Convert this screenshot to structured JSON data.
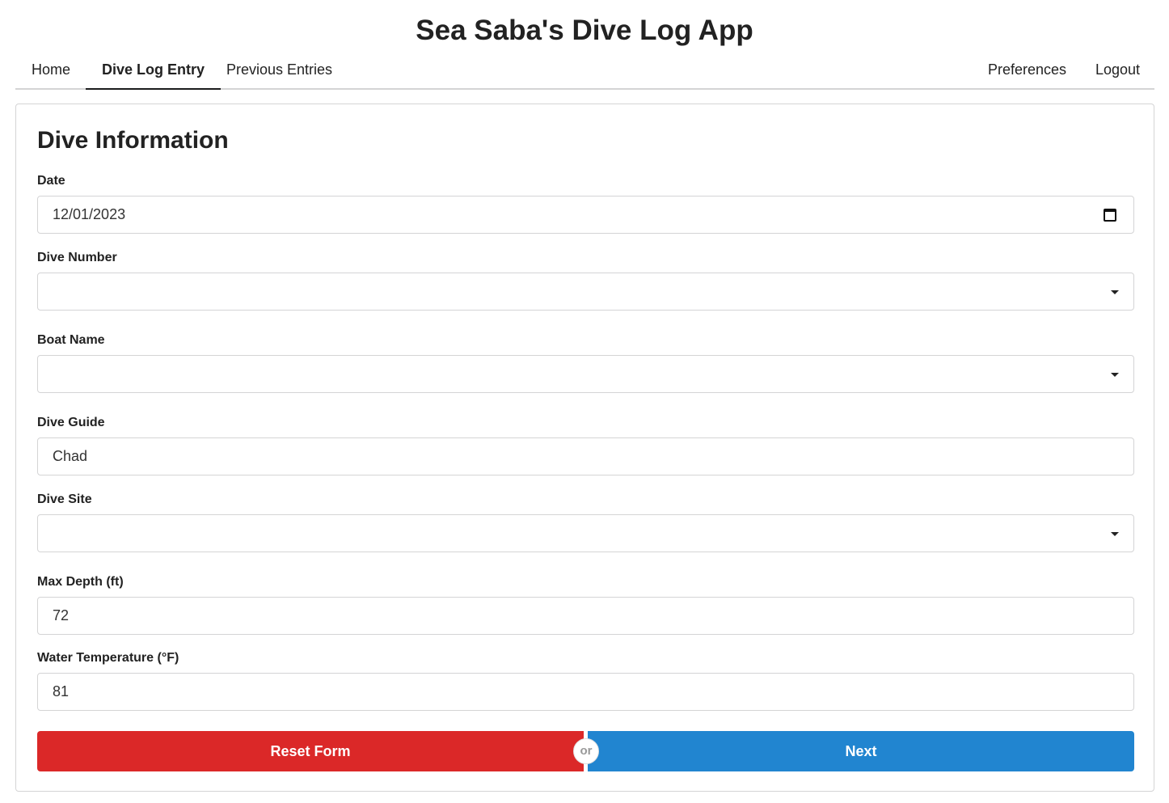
{
  "app": {
    "title": "Sea Saba's Dive Log App"
  },
  "nav": {
    "left": [
      {
        "label": "Home",
        "active": false
      },
      {
        "label": "Dive Log Entry",
        "active": true
      },
      {
        "label": "Previous Entries",
        "active": false
      }
    ],
    "right": [
      {
        "label": "Preferences"
      },
      {
        "label": "Logout"
      }
    ]
  },
  "form": {
    "title": "Dive Information",
    "fields": {
      "date": {
        "label": "Date",
        "value": "12/01/2023",
        "icon": "calendar-icon"
      },
      "dive_number": {
        "label": "Dive Number",
        "value": "",
        "icon": "caret-down-icon"
      },
      "boat_name": {
        "label": "Boat Name",
        "value": "",
        "icon": "caret-down-icon"
      },
      "dive_guide": {
        "label": "Dive Guide",
        "value": "Chad"
      },
      "dive_site": {
        "label": "Dive Site",
        "value": "",
        "icon": "caret-down-icon"
      },
      "max_depth": {
        "label": "Max Depth (ft)",
        "value": "72"
      },
      "water_temp": {
        "label": "Water Temperature (°F)",
        "value": "81"
      }
    },
    "buttons": {
      "reset": {
        "label": "Reset Form",
        "color": "#db2828"
      },
      "or": "or",
      "next": {
        "label": "Next",
        "color": "#2185d0"
      }
    }
  }
}
